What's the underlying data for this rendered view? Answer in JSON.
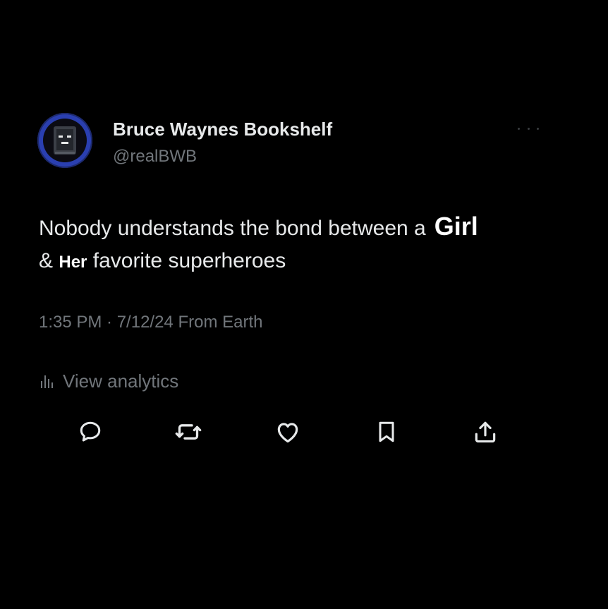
{
  "user": {
    "display_name": "Bruce Waynes Bookshelf",
    "handle": "@realBWB"
  },
  "tweet": {
    "text_part1": "Nobody understands the bond between a",
    "text_big": "Girl",
    "text_amp": "&",
    "text_her": "Her",
    "text_part2": "favorite superheroes"
  },
  "meta": {
    "timestamp": "1:35 PM · 7/12/24 From Earth"
  },
  "analytics": {
    "label": "View analytics",
    "icon": "analytics-bars-icon"
  },
  "actions": [
    {
      "name": "reply",
      "icon": "reply-icon"
    },
    {
      "name": "retweet",
      "icon": "retweet-icon"
    },
    {
      "name": "like",
      "icon": "heart-icon"
    },
    {
      "name": "bookmark",
      "icon": "bookmark-icon"
    },
    {
      "name": "share",
      "icon": "share-icon"
    }
  ],
  "colors": {
    "background": "#000000",
    "primary_text": "#e7e9ea",
    "secondary_text": "#71767b",
    "avatar_ring": "#2a3fb0"
  }
}
